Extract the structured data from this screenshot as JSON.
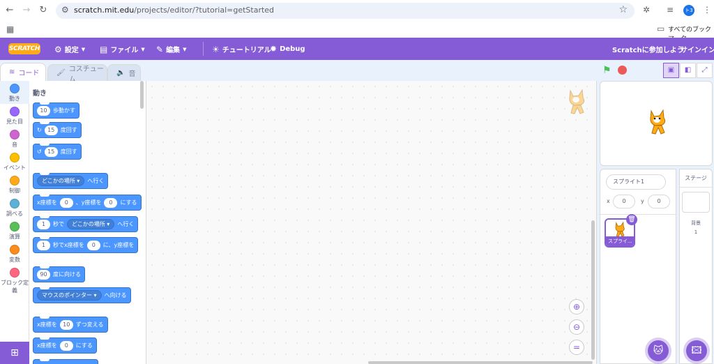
{
  "browser": {
    "url_host": "scratch.mit.edu",
    "url_path": "/projects/editor/?tutorial=getStarted",
    "avatar_text": "ト3",
    "bookmarks_label": "すべてのブックマーク"
  },
  "menubar": {
    "logo": "SCRATCH",
    "settings": "設定",
    "file": "ファイル",
    "edit": "編集",
    "tutorials": "チュートリアル",
    "debug": "Debug",
    "join": "Scratchに参加しよう",
    "signin": "サインイン"
  },
  "tabs": {
    "code": "コード",
    "costumes": "コスチューム",
    "sounds": "音"
  },
  "categories": [
    {
      "label": "動き",
      "color": "#4c97ff"
    },
    {
      "label": "見た目",
      "color": "#9966ff"
    },
    {
      "label": "音",
      "color": "#cf63cf"
    },
    {
      "label": "イベント",
      "color": "#ffbf00"
    },
    {
      "label": "制御",
      "color": "#ffab19"
    },
    {
      "label": "調べる",
      "color": "#5cb1d6"
    },
    {
      "label": "演算",
      "color": "#59c059"
    },
    {
      "label": "変数",
      "color": "#ff8c1a"
    },
    {
      "label": "ブロック定義",
      "color": "#ff6680"
    }
  ],
  "palette": {
    "heading": "動き",
    "move": {
      "num": "10",
      "text": "歩動かす"
    },
    "turn_right": {
      "num": "15",
      "text": "度回す"
    },
    "turn_left": {
      "num": "15",
      "text": "度回す"
    },
    "goto": {
      "drop": "どこかの場所",
      "text": "へ行く"
    },
    "gotoxy": {
      "a": "x座標を",
      "x": "0",
      "b": "、y座標を",
      "y": "0",
      "c": "にする"
    },
    "glide": {
      "num": "1",
      "a": "秒で",
      "drop": "どこかの場所",
      "b": "へ行く"
    },
    "glidexy": {
      "num": "1",
      "a": "秒でx座標を",
      "x": "0",
      "b": "に、y座標を"
    },
    "point": {
      "num": "90",
      "text": "度に向ける"
    },
    "pointto": {
      "drop": "マウスのポインター",
      "text": "へ向ける"
    },
    "changex": {
      "a": "x座標を",
      "num": "10",
      "b": "ずつ変える"
    },
    "setx": {
      "a": "x座標を",
      "num": "0",
      "b": "にする"
    }
  },
  "sprite_pane": {
    "name": "スプライト1",
    "x_label": "x",
    "x": "0",
    "y_label": "y",
    "y": "0",
    "thumb_caption": "スプライ..."
  },
  "stage_pane": {
    "title": "ステージ",
    "backdrops_label": "背景",
    "backdrops_count": "1"
  }
}
